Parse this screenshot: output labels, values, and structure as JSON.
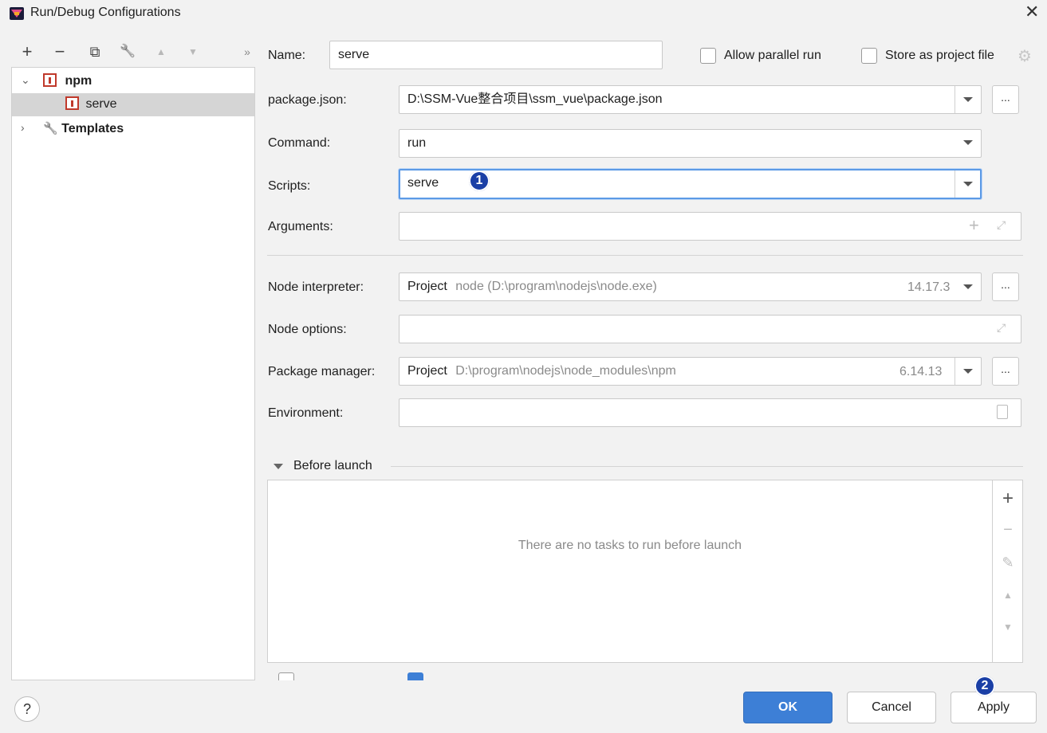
{
  "window": {
    "title": "Run/Debug Configurations",
    "close_glyph": "✕"
  },
  "toolbar": {
    "icons": [
      {
        "name": "add-icon",
        "glyph": "+"
      },
      {
        "name": "remove-icon",
        "glyph": "−"
      },
      {
        "name": "copy-icon",
        "glyph": "⧉"
      },
      {
        "name": "wrench-icon",
        "glyph": "🔧"
      },
      {
        "name": "move-up-icon",
        "glyph": "▲"
      },
      {
        "name": "move-down-icon",
        "glyph": "▼"
      },
      {
        "name": "more-icon",
        "glyph": "»"
      }
    ]
  },
  "tree": {
    "npm_label": "npm",
    "serve_label": "serve",
    "templates_label": "Templates"
  },
  "form": {
    "name_label": "Name:",
    "name_value": "serve",
    "allow_parallel_label": "Allow parallel run",
    "store_project_label": "Store as project file",
    "package_json_label": "package.json:",
    "package_json_value": "D:\\SSM-Vue整合项目\\ssm_vue\\package.json",
    "command_label": "Command:",
    "command_value": "run",
    "scripts_label": "Scripts:",
    "scripts_value": "serve",
    "arguments_label": "Arguments:",
    "node_interpreter_label": "Node interpreter:",
    "node_interpreter_prefix": "Project",
    "node_interpreter_path": "node (D:\\program\\nodejs\\node.exe)",
    "node_interpreter_version": "14.17.3",
    "node_options_label": "Node options:",
    "package_manager_label": "Package manager:",
    "package_manager_prefix": "Project",
    "package_manager_path": "D:\\program\\nodejs\\node_modules\\npm",
    "package_manager_version": "6.14.13",
    "environment_label": "Environment:",
    "dots": "..."
  },
  "before_launch": {
    "title": "Before launch",
    "empty_text": "There are no tasks to run before launch"
  },
  "annotations": {
    "badge1": "1",
    "badge2": "2"
  },
  "buttons": {
    "ok": "OK",
    "cancel": "Cancel",
    "apply": "Apply",
    "help": "?"
  },
  "colors": {
    "accent": "#3d7fd6",
    "badge": "#1a3fa6",
    "npm_red": "#c0392b"
  }
}
